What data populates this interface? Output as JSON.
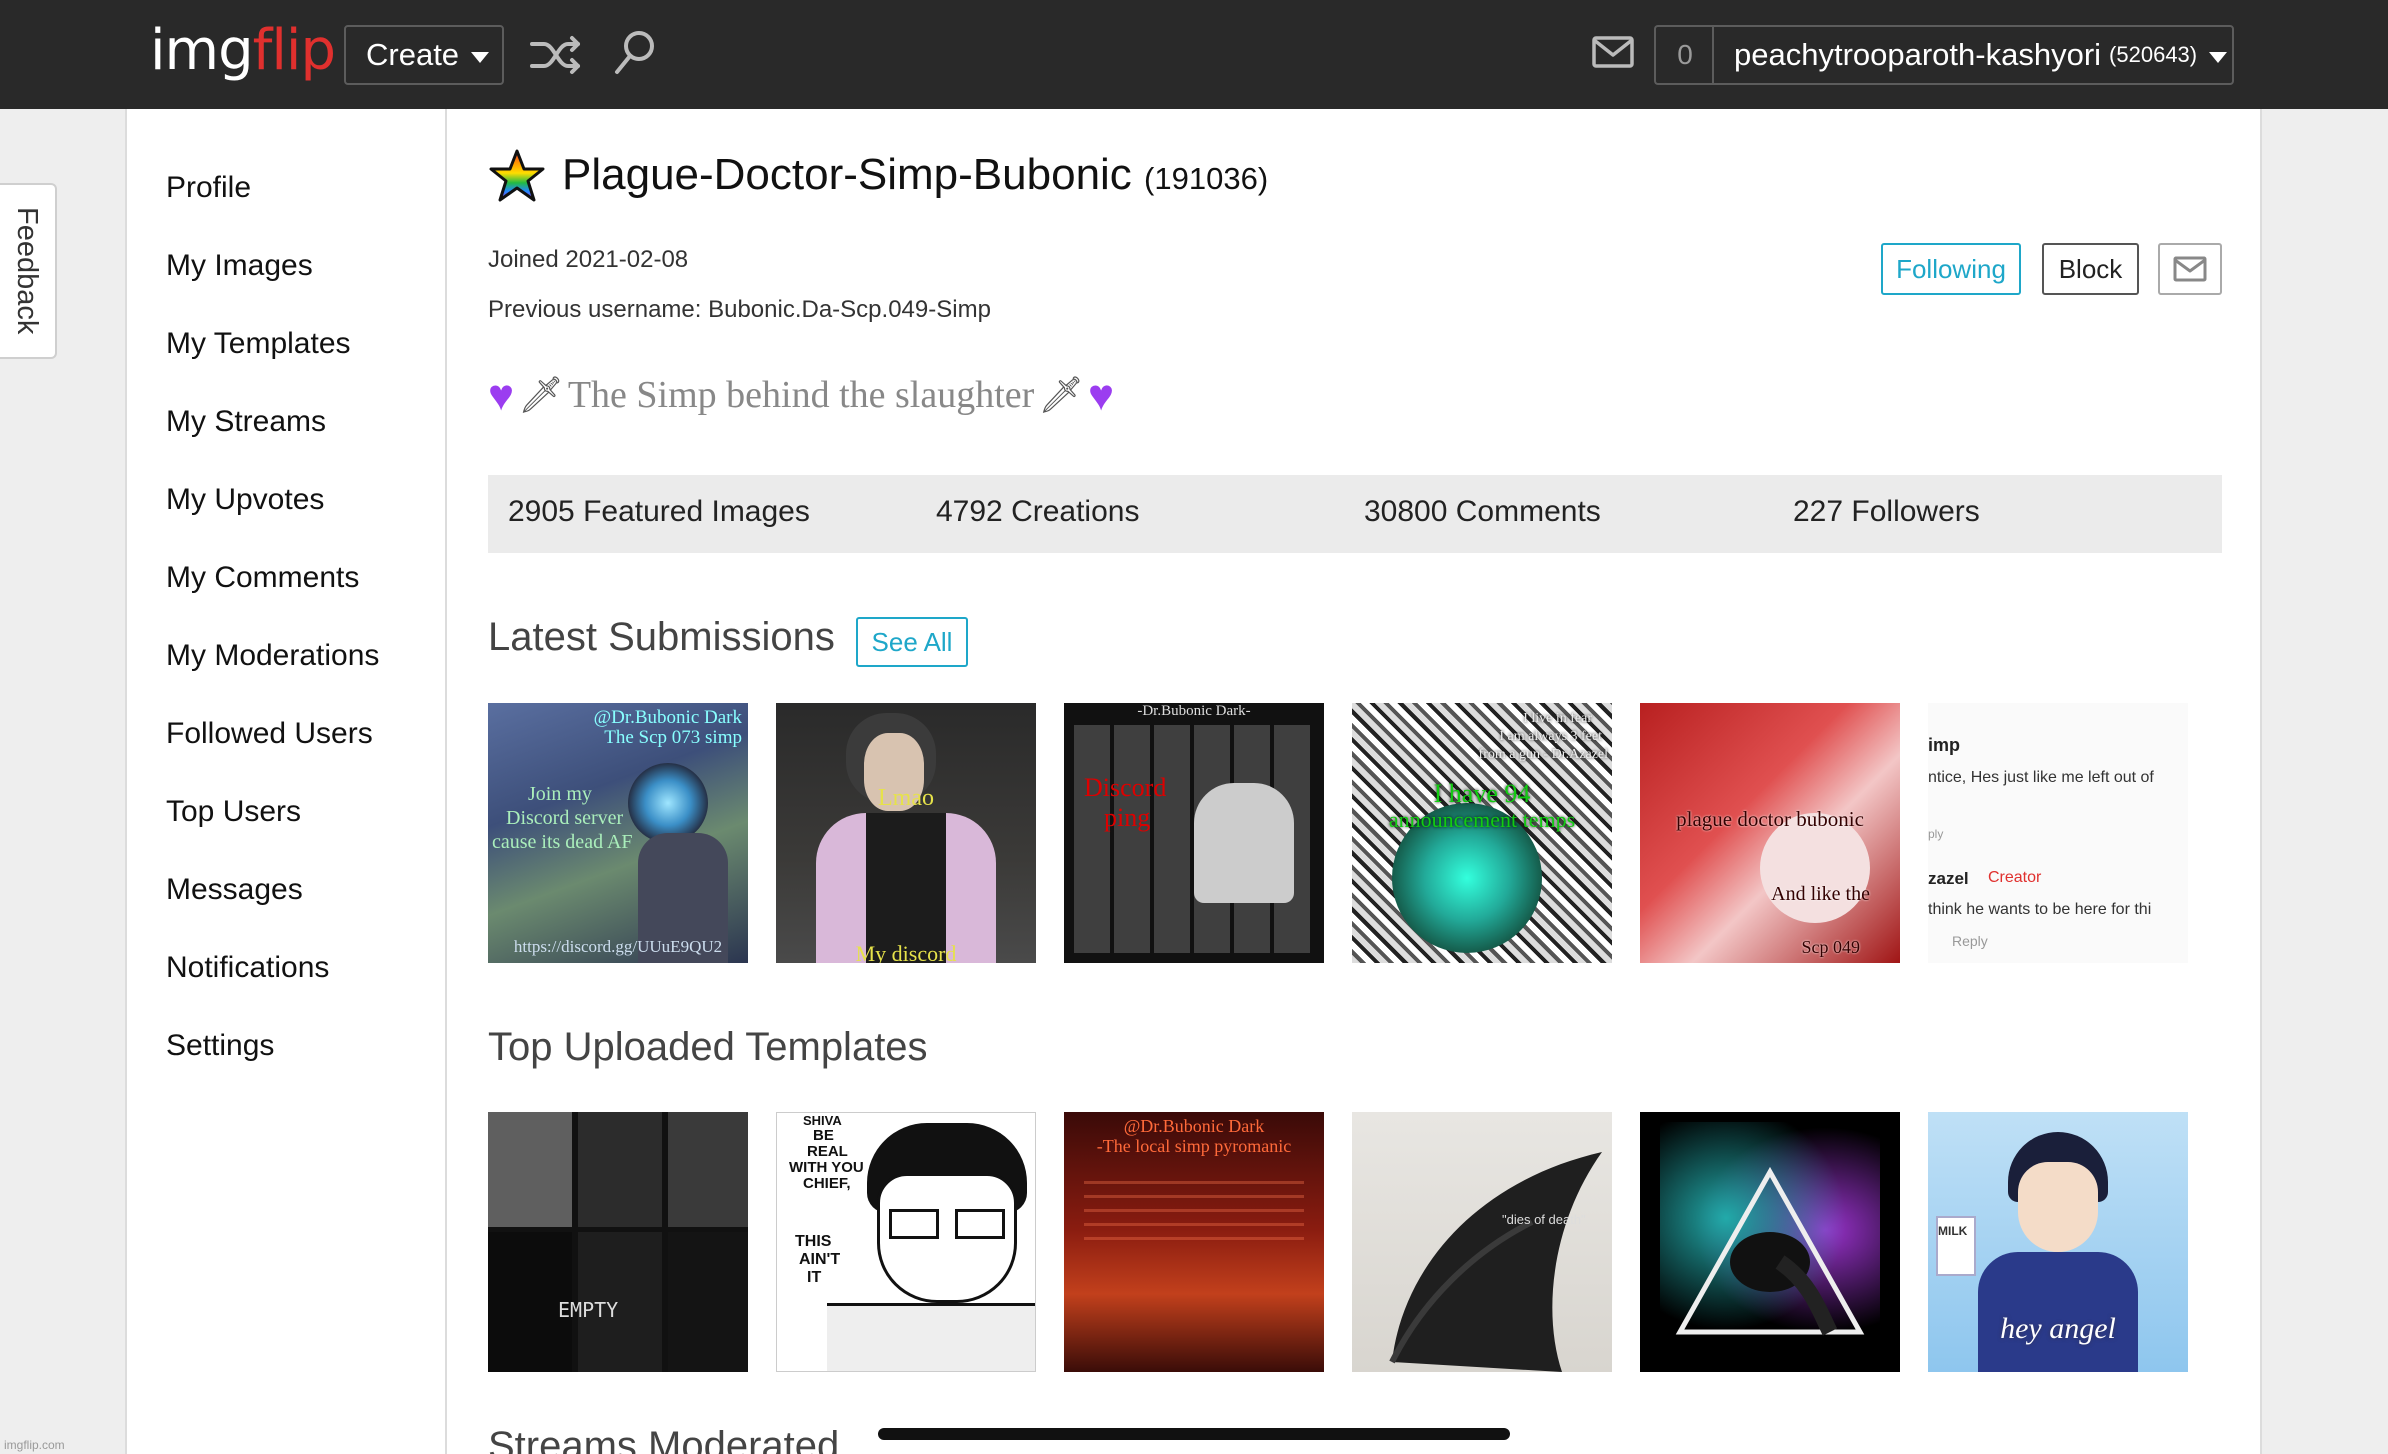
{
  "header": {
    "logo_part1": "img",
    "logo_part2": "flip",
    "create_label": "Create",
    "notif_count": "0",
    "username": "peachytrooparoth-kashyori",
    "user_points": "(520643)"
  },
  "feedback_label": "Feedback",
  "sidebar": {
    "items": [
      {
        "label": "Profile"
      },
      {
        "label": "My Images"
      },
      {
        "label": "My Templates"
      },
      {
        "label": "My Streams"
      },
      {
        "label": "My Upvotes"
      },
      {
        "label": "My Comments"
      },
      {
        "label": "My Moderations"
      },
      {
        "label": "Followed Users"
      },
      {
        "label": "Top Users"
      },
      {
        "label": "Messages"
      },
      {
        "label": "Notifications"
      },
      {
        "label": "Settings"
      }
    ]
  },
  "profile": {
    "name": "Plague-Doctor-Simp-Bubonic",
    "points": "(191036)",
    "joined": "Joined 2021-02-08",
    "previous_username": "Previous username: Bubonic.Da-Scp.049-Simp",
    "bio_text": "The Simp behind the slaughter",
    "following_label": "Following",
    "block_label": "Block"
  },
  "stats": {
    "featured": "2905 Featured Images",
    "creations": "4792 Creations",
    "comments": "30800 Comments",
    "followers": "227 Followers"
  },
  "latest": {
    "title": "Latest Submissions",
    "see_all": "See All",
    "thumbs": [
      {
        "line1": "@Dr.Bubonic Dark",
        "line2": "The Scp 073 simp",
        "line3": "Join my",
        "line4": "Discord server",
        "line5": "cause its dead AF",
        "footer": "https://discord.gg/UUuE9QU2"
      },
      {
        "line1": "Lmao",
        "footer": "My discord"
      },
      {
        "line1": "-Dr.Bubonic Dark-",
        "line2": "Discord",
        "line3": "ping"
      },
      {
        "line1": "I live in fear",
        "line2": "I am always 3 feet",
        "line3": "from a gun - Dr.Azazel",
        "line4": "I have 94",
        "line5": "announcement temps"
      },
      {
        "line1": "plague doctor bubonic",
        "line2": "And like the",
        "line3": "Scp 049"
      },
      {
        "line1": "imp",
        "line2": "ntice, Hes just like me left out of",
        "line3": "ply",
        "line4": "zazel",
        "line5": "Creator",
        "line6": "think he wants to be here for thi",
        "line7": "Reply"
      }
    ]
  },
  "templates": {
    "title": "Top Uploaded Templates",
    "thumbs": [
      {
        "caption": "EMPTY"
      },
      {
        "caption1": "SHIVA",
        "caption2": "BE",
        "caption3": "REAL",
        "caption4": "WITH YOU",
        "caption5": "CHIEF,",
        "caption6": "THIS",
        "caption7": "AIN'T",
        "caption8": "IT"
      },
      {
        "line1": "@Dr.Bubonic Dark",
        "line2": "-The local simp pyromanic"
      },
      {
        "caption": "\"dies of death\""
      },
      {
        "caption": ""
      },
      {
        "caption": "hey angel",
        "caption2": "MILK"
      }
    ]
  },
  "streams_title": "Streams Moderated",
  "watermark": "imgflip.com",
  "colors": {
    "accent": "#1ea7c9",
    "header_bg": "#292929",
    "logo_red": "#e0302e",
    "heart": "#9b3df0"
  }
}
